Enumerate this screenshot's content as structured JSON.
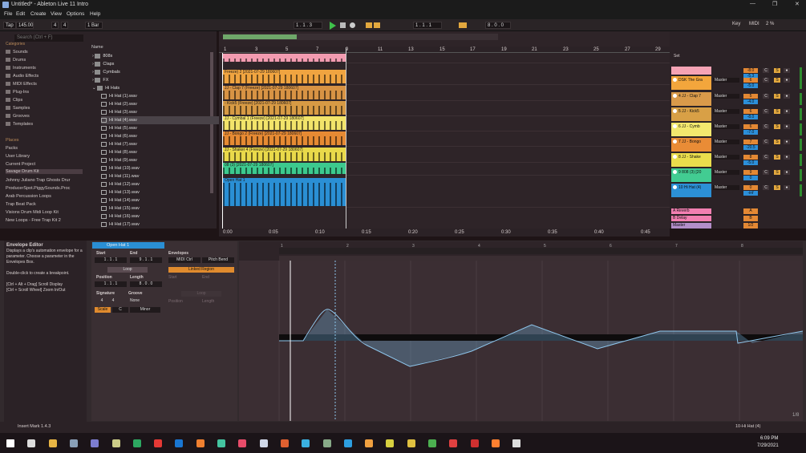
{
  "window": {
    "title": "Untitled* - Ableton Live 11 Intro",
    "minimize": "—",
    "maximize": "❐",
    "close": "✕"
  },
  "menu": [
    "File",
    "Edit",
    "Create",
    "View",
    "Options",
    "Help"
  ],
  "transport": {
    "tap": "Tap",
    "tempo": "145.00",
    "sig_num": "4",
    "sig_den": "4",
    "quantize": "1 Bar",
    "position": "1 .  1 .  3",
    "loop_start": "1 .  1 .  1",
    "loop_len": "8 .  0 .  0",
    "key": "Key",
    "midi": "MIDI",
    "cpu": "2 %"
  },
  "browser": {
    "search_placeholder": "Search (Ctrl + F)",
    "categories_label": "Categories",
    "categories": [
      "Sounds",
      "Drums",
      "Instruments",
      "Audio Effects",
      "MIDI Effects",
      "Plug-Ins",
      "Clips",
      "Samples",
      "Grooves",
      "Templates"
    ],
    "places_label": "Places",
    "places": [
      "Packs",
      "User Library",
      "Current Project",
      "Savage Drum Kit",
      "Johnny Juliano Trap Ghosts Drur",
      "ProducerSpot.PiggySounds.Proc",
      "Arab Percussion Loops",
      "Trap Beat Pack",
      "Visions Drum Midi Loop Kit",
      "New Loops - Free Trap Kit 2"
    ],
    "name_header": "Name",
    "folders": [
      "808s",
      "Claps",
      "Cymbals",
      "FX",
      "Hi Hats"
    ],
    "files": [
      "Hi Hat (1).wav",
      "Hi Hat (2).wav",
      "Hi Hat (3).wav",
      "Hi Hat (4).wav",
      "Hi Hat (5).wav",
      "Hi Hat (6).wav",
      "Hi Hat (7).wav",
      "Hi Hat (8).wav",
      "Hi Hat (9).wav",
      "Hi Hat (10).wav",
      "Hi Hat (11).wav",
      "Hi Hat (12).wav",
      "Hi Hat (13).wav",
      "Hi Hat (14).wav",
      "Hi Hat (15).wav",
      "Hi Hat (16).wav",
      "Hi Hat (17).wav"
    ]
  },
  "arrangement": {
    "bars": [
      "1",
      "5",
      "9",
      "13",
      "17",
      "21",
      "25",
      "29"
    ],
    "bars_odd": [
      "3",
      "7",
      "11",
      "15",
      "19",
      "23",
      "27"
    ],
    "times": [
      "0:00",
      "0:05",
      "0:10",
      "0:15",
      "0:20",
      "0:25",
      "0:30",
      "0:35",
      "0:40",
      "0:45"
    ],
    "clips": [
      {
        "label": "",
        "color": "#f29bb0"
      },
      {
        "label": "Freeze) 2 [2021-07-29 180607]",
        "color": "#f0a440"
      },
      {
        "label": "JJ - Clap 7 (Freeze) [2021-07-29 180607]",
        "color": "#d89344"
      },
      {
        "label": "- Kick5 (Freeze) [2021-07-29 180607]",
        "color": "#d79a44"
      },
      {
        "label": "JJ - Cymbal 1 (Freeze) [2021-07-29 180607]",
        "color": "#f2e46a"
      },
      {
        "label": "JJ - Bongo 2 (Freeze) [2021-07-29 180607]",
        "color": "#e68a33"
      },
      {
        "label": "JJ - Shaker 4 (Freeze) [2021-07-29 180607]",
        "color": "#e9d94a"
      },
      {
        "label": "08 (3) [2021-07-29 180607]",
        "color": "#3cc98e"
      },
      {
        "label": "Open Hat 1",
        "color": "#2a8fd4"
      }
    ],
    "set_label": "Set"
  },
  "mixer": {
    "tracks": [
      {
        "name": "",
        "color": "#f5a3b5",
        "route": "",
        "vol": "-8.0",
        "pan": "C",
        "vol2": "-5.3",
        "num": ""
      },
      {
        "name": "DSK The Gra",
        "color": "#f3a63c",
        "route": "Master",
        "vol": "6",
        "pan": "C",
        "vol2": "-5.0",
        "num": ""
      },
      {
        "name": "4 JJ - Clap 7",
        "color": "#d99a4a",
        "route": "Master",
        "vol": "5",
        "pan": "C",
        "vol2": "-4.0",
        "num": ""
      },
      {
        "name": "5 JJ - Kick5",
        "color": "#d8a046",
        "route": "Master",
        "vol": "6",
        "pan": "C",
        "vol2": "-8.0",
        "num": ""
      },
      {
        "name": "6 JJ - Cymb",
        "color": "#f3e86e",
        "route": "Master",
        "vol": "6",
        "pan": "C",
        "vol2": "-7.0",
        "num": ""
      },
      {
        "name": "7 JJ - Bongo",
        "color": "#e98c36",
        "route": "Master",
        "vol": "7",
        "pan": "C",
        "vol2": "-20.5",
        "num": ""
      },
      {
        "name": "8 JJ - Shake",
        "color": "#eadd4c",
        "route": "Master",
        "vol": "8",
        "pan": "C",
        "vol2": "-5.0",
        "num": ""
      },
      {
        "name": "9 808 (3) [20",
        "color": "#42cc92",
        "route": "Master",
        "vol": "9",
        "pan": "C",
        "vol2": "0",
        "num": ""
      },
      {
        "name": "10 Hi Hat (4)",
        "color": "#2c90d6",
        "route": "Master",
        "vol": "0",
        "pan": "C",
        "vol2": "-inf",
        "num": ""
      }
    ],
    "in_label": "In",
    "auto_label": "Auto",
    "off_label": "Off",
    "returns": [
      {
        "name": "A Reverb",
        "color": "#f27fb1",
        "val": "A"
      },
      {
        "name": "B Delay",
        "color": "#f27fb1",
        "val": "B"
      },
      {
        "name": "Master",
        "color": "#b38ec9",
        "val": "1/2"
      }
    ],
    "post": "Post",
    "inf_a": "-inf",
    "inf_b": "-inf"
  },
  "info_view": {
    "title": "Envelope Editor",
    "body": "Displays a clip's automation envelope for a parameter. Choose a parameter in the Envelopes Box.",
    "hint1": "Double-click to create a breakpoint.",
    "hint2": "[Ctrl + Alt + Drag] Scroll Display",
    "hint3": "[Ctrl + Scroll Wheel] Zoom In/Out"
  },
  "clip_view": {
    "clip_name": "Open Hat 1",
    "start": "Start",
    "end": "End",
    "start_val": "1 .  1 .  1",
    "end_val": "9 .  1 .  1",
    "loop": "Loop",
    "position": "Position",
    "length": "Length",
    "pos_val": "1 .  1 .  1",
    "len_val": "8 .  0 .  0",
    "signature": "Signature",
    "groove": "Groove",
    "sig_num": "4",
    "sig_den": "4",
    "groove_val": "None",
    "scale": "Scale",
    "scale_root": "C",
    "scale_mode": "Minor"
  },
  "envelopes": {
    "title": "Envelopes",
    "device": "MIDI Ctrl",
    "param": "Pitch Bend",
    "linked": "Linked Region",
    "start": "Start",
    "end": "End",
    "loop": "Loop",
    "position": "Position",
    "length": "Length"
  },
  "env_ruler": [
    "1",
    "2",
    "3",
    "4",
    "5",
    "6",
    "7",
    "8"
  ],
  "status": {
    "text": "Insert Mark 1.4.3",
    "track": "10-Hi Hat (4)"
  },
  "taskbar": {
    "time": "6:09 PM",
    "date": "7/29/2021"
  },
  "page": "1/8"
}
